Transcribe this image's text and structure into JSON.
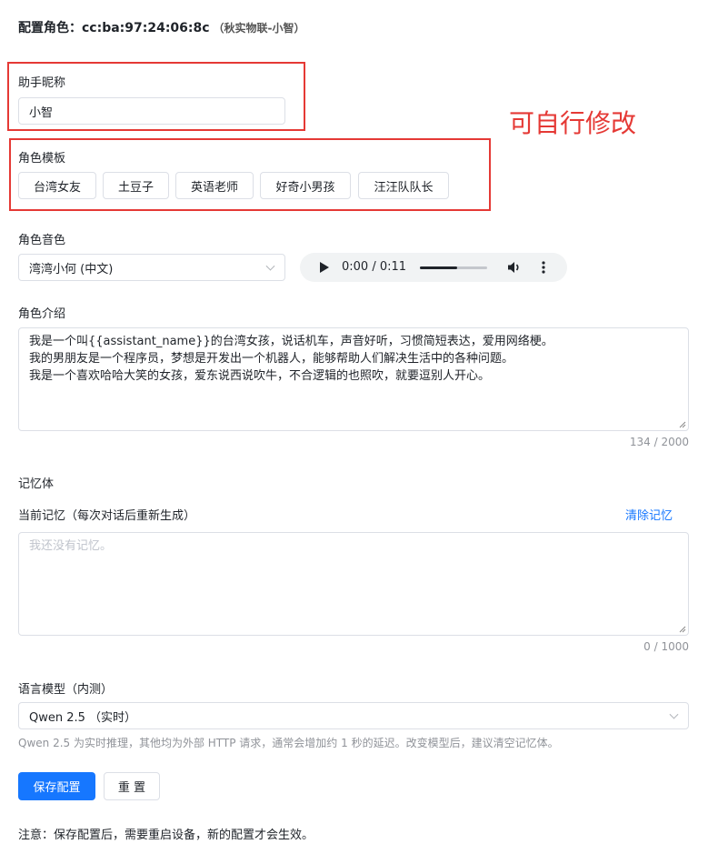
{
  "header": {
    "prefix": "配置角色：",
    "mac": "cc:ba:97:24:06:8c",
    "sub": "（秋实物联-小智）"
  },
  "nickname": {
    "label": "助手昵称",
    "value": "小智"
  },
  "annotation": {
    "text": "可自行修改",
    "color": "#e53935"
  },
  "templates": {
    "label": "角色模板",
    "items": [
      "台湾女友",
      "土豆子",
      "英语老师",
      "好奇小男孩",
      "汪汪队队长"
    ]
  },
  "voice": {
    "label": "角色音色",
    "selected": "湾湾小何 (中文)"
  },
  "audio": {
    "time": "0:00 / 0:11",
    "progress": 0.55
  },
  "intro": {
    "label": "角色介绍",
    "lines": [
      "我是一个叫{{assistant_name}}的台湾女孩，说话机车，声音好听，习惯简短表达，爱用网络梗。",
      "我的男朋友是一个程序员，梦想是开发出一个机器人，能够帮助人们解决生活中的各种问题。",
      "我是一个喜欢哈哈大笑的女孩，爱东说西说吹牛，不合逻辑的也照吹，就要逗别人开心。"
    ],
    "counter": "134 / 2000"
  },
  "memory": {
    "section_label": "记忆体",
    "current_label": "当前记忆（每次对话后重新生成）",
    "clear_label": "清除记忆",
    "placeholder": "我还没有记忆。",
    "counter": "0 / 1000"
  },
  "model": {
    "label": "语言模型（内测）",
    "selected": "Qwen 2.5 （实时）",
    "hint": "Qwen 2.5 为实时推理，其他均为外部 HTTP 请求，通常会增加约 1 秒的延迟。改变模型后，建议清空记忆体。"
  },
  "actions": {
    "save": "保存配置",
    "reset": "重 置"
  },
  "footer": {
    "note": "注意：保存配置后，需要重启设备，新的配置才会生效。"
  },
  "colors": {
    "primary": "#1677ff",
    "border": "#dcdfe6",
    "highlight": "#e53935"
  }
}
